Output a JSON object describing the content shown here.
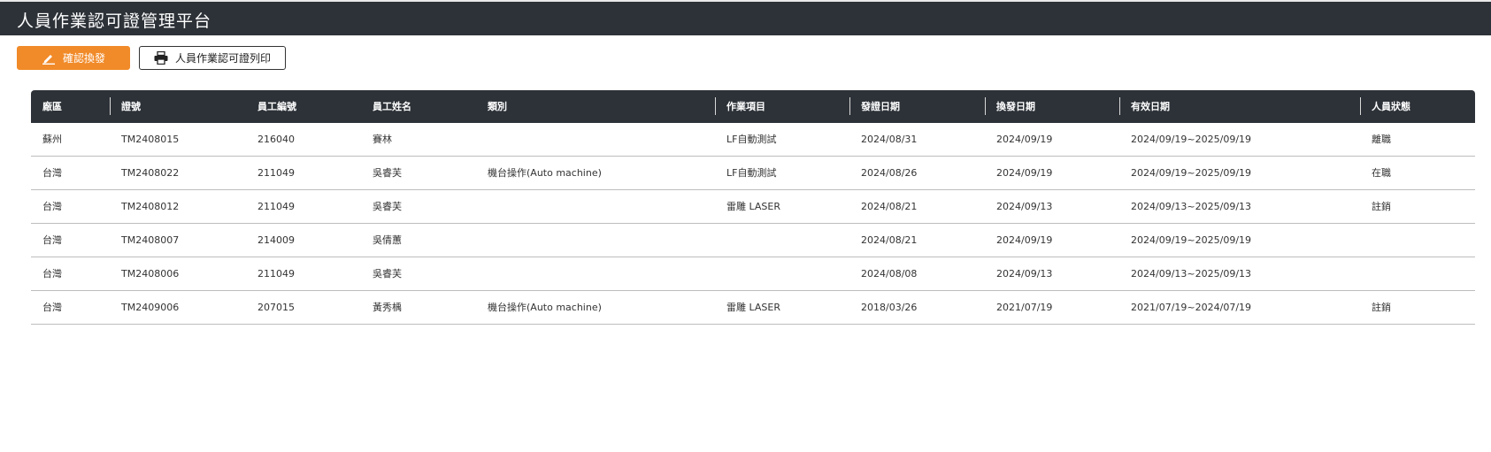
{
  "app": {
    "title": "人員作業認可證管理平台"
  },
  "toolbar": {
    "confirm_label": "確認換發",
    "print_label": "人員作業認可證列印"
  },
  "table": {
    "columns": [
      "廠區",
      "證號",
      "員工編號",
      "員工姓名",
      "類別",
      "作業項目",
      "發證日期",
      "換發日期",
      "有效日期",
      "人員狀態"
    ],
    "rows": [
      [
        "蘇州",
        "TM2408015",
        "216040",
        "賽林",
        "",
        "LF自動測試",
        "2024/08/31",
        "2024/09/19",
        "2024/09/19~2025/09/19",
        "離職"
      ],
      [
        "台灣",
        "TM2408022",
        "211049",
        "吳睿芙",
        "機台操作(Auto machine)",
        "LF自動測試",
        "2024/08/26",
        "2024/09/19",
        "2024/09/19~2025/09/19",
        "在職"
      ],
      [
        "台灣",
        "TM2408012",
        "211049",
        "吳睿芙",
        "",
        "雷雕 LASER",
        "2024/08/21",
        "2024/09/13",
        "2024/09/13~2025/09/13",
        "註銷"
      ],
      [
        "台灣",
        "TM2408007",
        "214009",
        "吳倩蕙",
        "",
        "",
        "2024/08/21",
        "2024/09/19",
        "2024/09/19~2025/09/19",
        ""
      ],
      [
        "台灣",
        "TM2408006",
        "211049",
        "吳睿芙",
        "",
        "",
        "2024/08/08",
        "2024/09/13",
        "2024/09/13~2025/09/13",
        ""
      ],
      [
        "台灣",
        "TM2409006",
        "207015",
        "黃秀楀",
        "機台操作(Auto machine)",
        "雷雕 LASER",
        "2018/03/26",
        "2021/07/19",
        "2021/07/19~2024/07/19",
        "註銷"
      ]
    ]
  },
  "colors": {
    "header_bg": "#2d3238",
    "accent": "#f18a28"
  }
}
